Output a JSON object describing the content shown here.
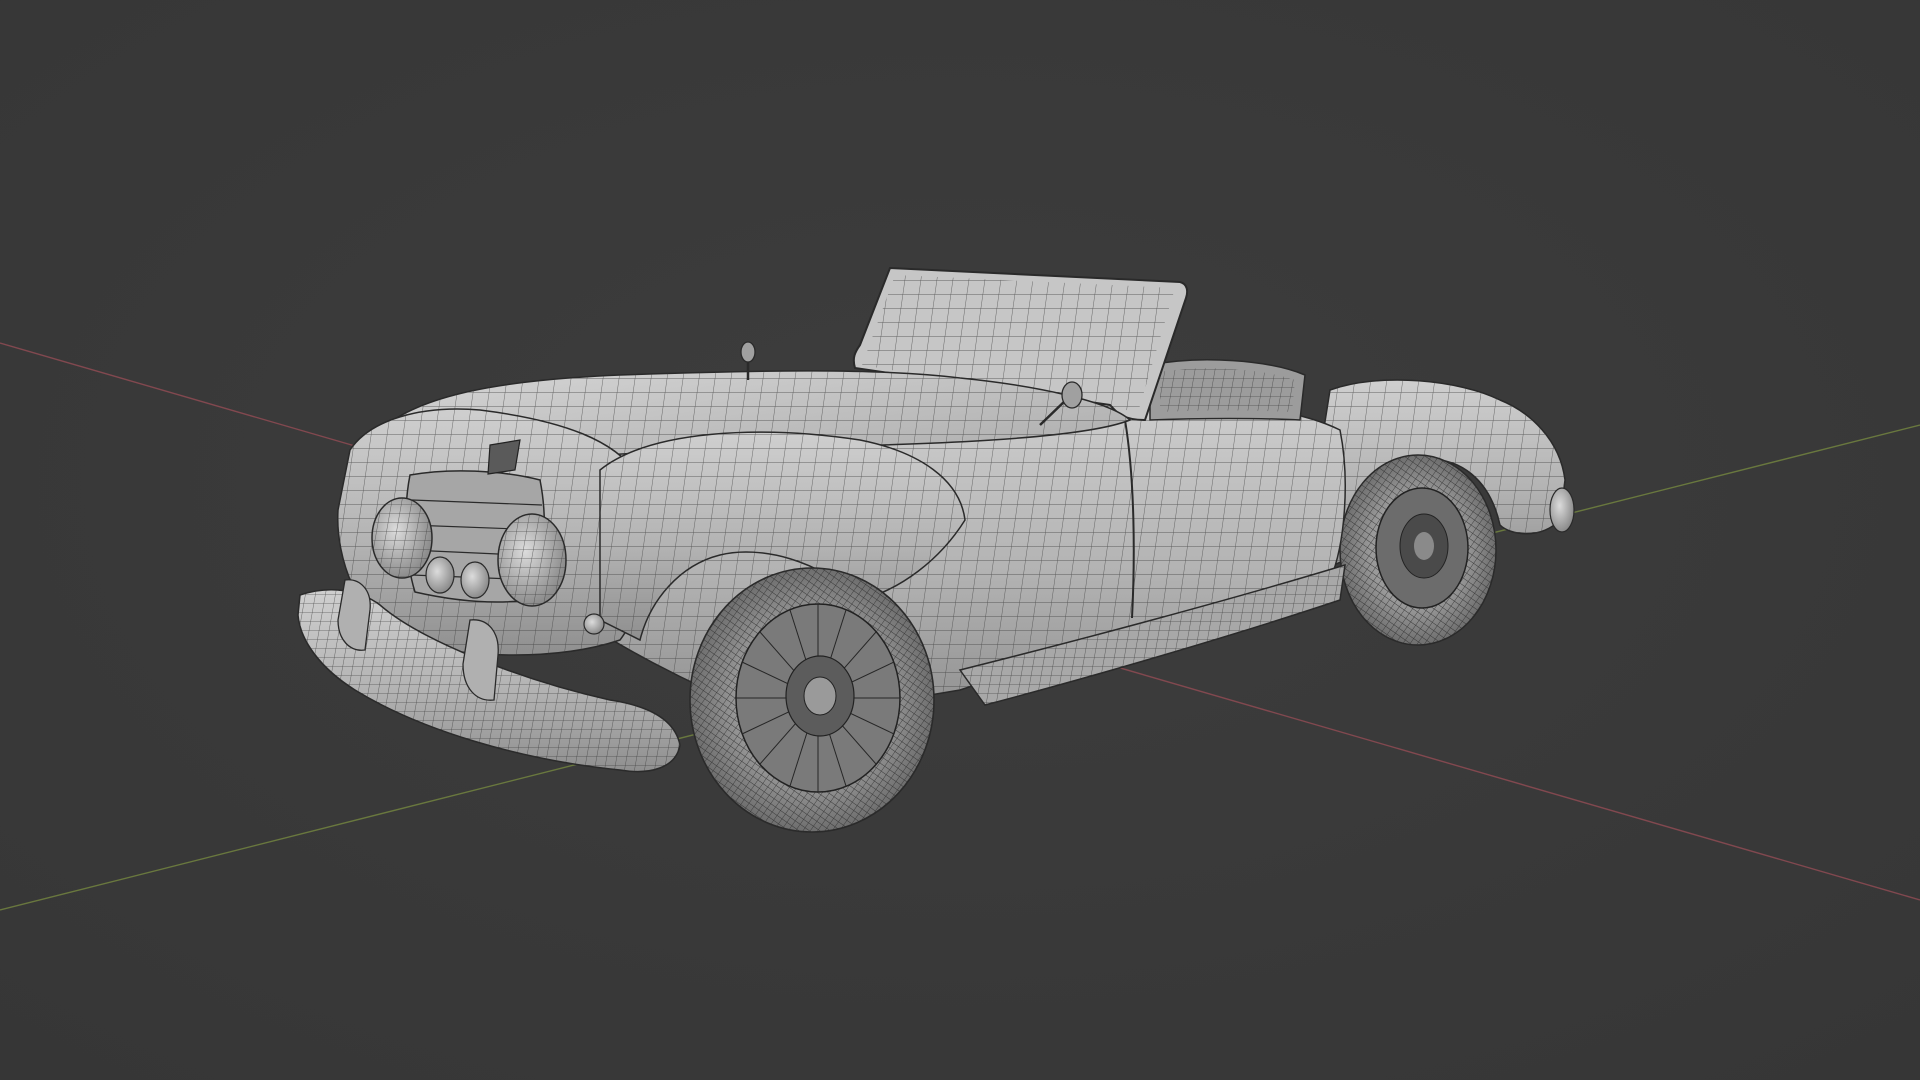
{
  "viewport": {
    "background": "#3a3a3a",
    "axis_x_color": "#8a4a52",
    "axis_y_color": "#6f7f3f",
    "model_fill": "#b9b9b9",
    "model_wire": "#2a2a2a",
    "model_highlight": "#d4d4d4",
    "model_shadow": "#8d8d8d"
  },
  "model": {
    "subject": "vintage-roadster",
    "display_mode": "solid-with-wireframe"
  }
}
